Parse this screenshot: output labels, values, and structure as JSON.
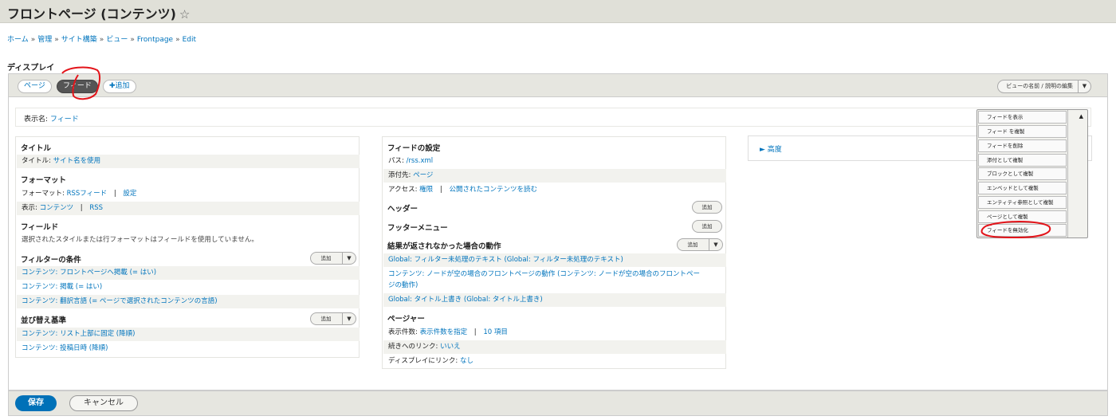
{
  "page": {
    "title": "フロントページ (コンテンツ)",
    "star": "☆"
  },
  "breadcrumb": [
    "ホーム",
    "管理",
    "サイト構築",
    "ビュー",
    "Frontpage",
    "Edit"
  ],
  "breadcrumb_sep": "»",
  "section_title": "ディスプレイ",
  "tabs": {
    "page": "ページ",
    "feed": "フィード",
    "add_plus": "✚",
    "add": "追加"
  },
  "edit_view": {
    "label": "ビューの名前 / 説明の編集",
    "caret": "▼"
  },
  "display_name": {
    "label": "表示名:",
    "value": "フィード"
  },
  "left": {
    "title_h": "タイトル",
    "title_label": "タイトル:",
    "title_value": "サイト名を使用",
    "format_h": "フォーマット",
    "format_label": "フォーマット:",
    "format_value": "RSSフィード",
    "format_settings": "設定",
    "show_label": "表示:",
    "show_value": "コンテンツ",
    "show_rss": "RSS",
    "fields_h": "フィールド",
    "fields_note": "選択されたスタイルまたは行フォーマットはフィールドを使用していません。",
    "filters_h": "フィルターの条件",
    "filters": [
      "コンテンツ: フロントページへ掲載 (= はい)",
      "コンテンツ: 掲載 (= はい)",
      "コンテンツ: 翻訳言語 (= ページで選択されたコンテンツの言語)"
    ],
    "sort_h": "並び替え基準",
    "sorts": [
      "コンテンツ: リスト上部に固定 (降順)",
      "コンテンツ: 投稿日時 (降順)"
    ],
    "add_btn": "追加",
    "caret": "▼",
    "pipe": "|"
  },
  "middle": {
    "feed_h": "フィードの設定",
    "path_label": "パス:",
    "path_value": "/rss.xml",
    "attach_label": "添付先:",
    "attach_value": "ページ",
    "access_label": "アクセス:",
    "access_value": "権限",
    "access_value2": "公開されたコンテンツを読む",
    "header_h": "ヘッダー",
    "footer_h": "フッターメニュー",
    "noresult_h": "結果が返されなかった場合の動作",
    "noresult": [
      "Global: フィルター未処理のテキスト (Global: フィルター未処理のテキスト)",
      "コンテンツ: ノードが空の場合のフロントページの動作 (コンテンツ: ノードが空の場合のフロントペー",
      "ジの動作)",
      "Global: タイトル上書き (Global: タイトル上書き)"
    ],
    "pager_h": "ページャー",
    "items_label": "表示件数:",
    "items_value": "表示件数を指定",
    "items_count": "10 項目",
    "more_label": "続きへのリンク:",
    "more_value": "いいえ",
    "link_label": "ディスプレイにリンク:",
    "link_value": "なし",
    "add_btn": "追加",
    "caret": "▼",
    "pipe": "|"
  },
  "right": {
    "advanced": "► 高度"
  },
  "dropdown": {
    "caret": "▲",
    "items": [
      "フィードを表示",
      "フィード を複製",
      "フィードを削除",
      "添付として複製",
      "ブロックとして複製",
      "エンベッドとして複製",
      "エンティティ参照として複製",
      "ページとして複製",
      "フィードを無効化"
    ]
  },
  "footer": {
    "save": "保存",
    "cancel": "キャンセル"
  },
  "colors": {
    "link": "#0074bd",
    "primary": "#0071b8",
    "annotation": "#e3141a"
  }
}
